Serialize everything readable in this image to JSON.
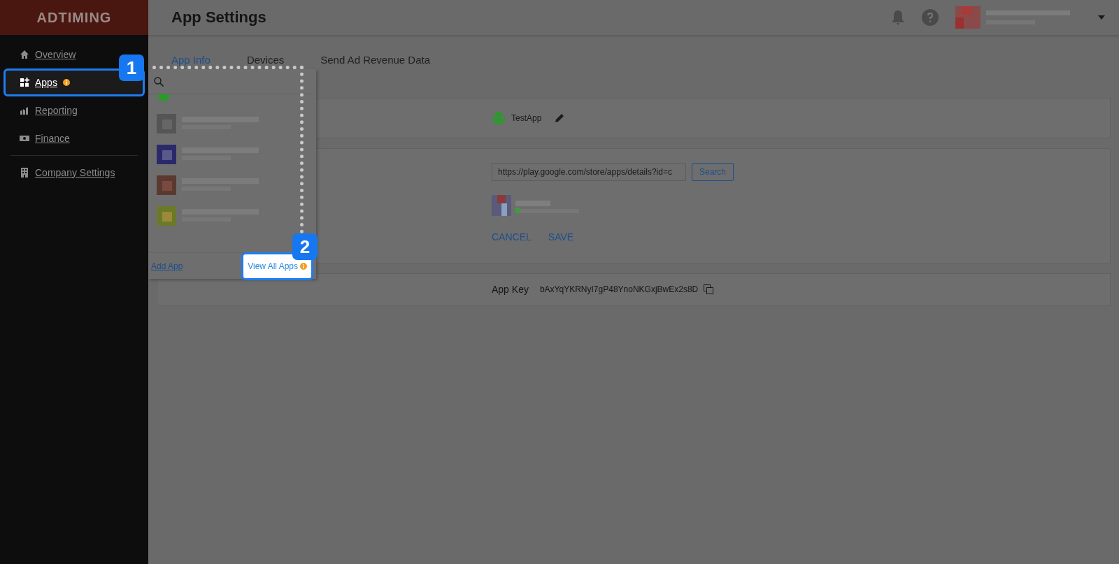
{
  "sidebar": {
    "logo": "ADTIMING",
    "sections": [
      {
        "items": [
          {
            "label": "Overview",
            "kind": "home",
            "selected": false,
            "info": false,
            "highlighted": false
          },
          {
            "label": "Apps",
            "kind": "apps",
            "selected": true,
            "info": true,
            "highlighted": true
          },
          {
            "label": "Reporting",
            "kind": "chart",
            "selected": false,
            "info": false,
            "highlighted": false
          },
          {
            "label": "Finance",
            "kind": "money",
            "selected": false,
            "info": false,
            "highlighted": false
          }
        ]
      },
      {
        "items": [
          {
            "label": "Company Settings",
            "kind": "building",
            "selected": false,
            "info": false,
            "highlighted": false
          }
        ]
      }
    ]
  },
  "header": {
    "title": "App Settings"
  },
  "tabs": [
    {
      "label": "App Info",
      "selected": true
    },
    {
      "label": "Devices",
      "selected": false
    },
    {
      "label": "Send Ad Revenue Data",
      "selected": false
    }
  ],
  "app_info": {
    "app_name": "TestApp",
    "store_url": "https://play.google.com/store/apps/details?id=c",
    "search_button": "Search",
    "cancel": "CANCEL",
    "save": "SAVE",
    "app_key_label": "App Key",
    "app_key": "bAxYqYKRNyI7gP48YnoNKGxjBwEx2s8D"
  },
  "app_menu": {
    "items": [
      {
        "kind": "android"
      },
      {
        "kind": "picture"
      },
      {
        "kind": "picture"
      },
      {
        "kind": "picture"
      },
      {
        "kind": "picture"
      }
    ],
    "add_app": "Add App",
    "view_all": {
      "label": "View All Apps",
      "info": true,
      "highlighted": true
    }
  },
  "callouts": [
    {
      "label": "1"
    },
    {
      "label": "2"
    }
  ]
}
